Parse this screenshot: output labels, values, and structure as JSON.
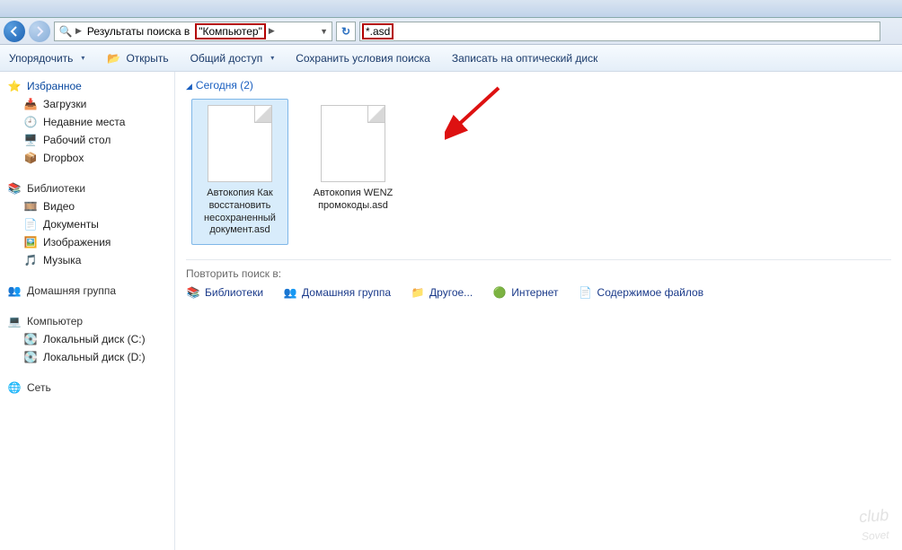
{
  "address": {
    "prefix": "Результаты поиска в",
    "location_quoted": "\"Компьютер\"",
    "search_query": "*.asd"
  },
  "toolbar": {
    "organize": "Упорядочить",
    "open": "Открыть",
    "share": "Общий доступ",
    "save_search": "Сохранить условия поиска",
    "burn": "Записать на оптический диск"
  },
  "sidebar": {
    "favorites": "Избранное",
    "fav_items": [
      "Загрузки",
      "Недавние места",
      "Рабочий стол",
      "Dropbox"
    ],
    "libraries": "Библиотеки",
    "lib_items": [
      "Видео",
      "Документы",
      "Изображения",
      "Музыка"
    ],
    "homegroup": "Домашняя группа",
    "computer": "Компьютер",
    "comp_items": [
      "Локальный диск (C:)",
      "Локальный диск (D:)"
    ],
    "network": "Сеть"
  },
  "content": {
    "group_label": "Сегодня (2)",
    "files": [
      {
        "name": "Автокопия Как восстановить несохраненный документ.asd",
        "selected": true
      },
      {
        "name": "Автокопия WENZ промокоды.asd",
        "selected": false
      }
    ],
    "repeat_label": "Повторить поиск в:",
    "repeat_targets": [
      "Библиотеки",
      "Домашняя группа",
      "Другое...",
      "Интернет",
      "Содержимое файлов"
    ]
  },
  "watermark": {
    "line1": "club",
    "line2": "Sovet"
  }
}
